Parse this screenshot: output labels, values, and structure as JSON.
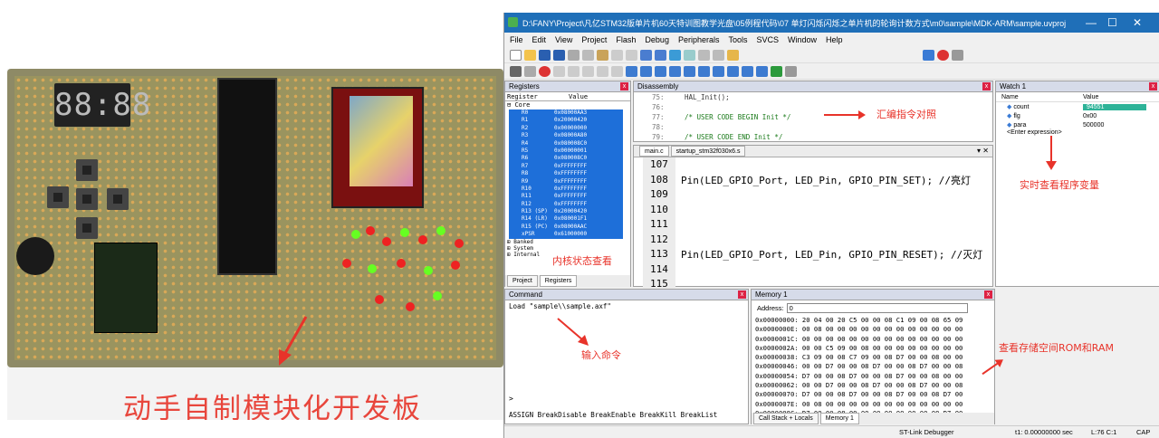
{
  "photo": {
    "caption": "动手自制模块化开发板",
    "display_digits": "88:88"
  },
  "ide": {
    "title": "D:\\FANY\\Project\\凡亿STM32版单片机60天特训图教学光盘\\05例程代码\\07 单灯闪烁闪烁之单片机的轮询计数方式\\m0\\sample\\MDK-ARM\\sample.uvprojx - µVision",
    "menu": [
      "File",
      "Edit",
      "View",
      "Project",
      "Flash",
      "Debug",
      "Peripherals",
      "Tools",
      "SVCS",
      "Window",
      "Help"
    ],
    "registers": {
      "title": "Registers",
      "col_register": "Register",
      "col_value": "Value",
      "group": "Core",
      "rows": [
        {
          "name": "R0",
          "value": "0x08000AA3"
        },
        {
          "name": "R1",
          "value": "0x20000420"
        },
        {
          "name": "R2",
          "value": "0x00000000"
        },
        {
          "name": "R3",
          "value": "0x08000A80"
        },
        {
          "name": "R4",
          "value": "0x080008C0"
        },
        {
          "name": "R5",
          "value": "0x00000001"
        },
        {
          "name": "R6",
          "value": "0x080008C0"
        },
        {
          "name": "R7",
          "value": "0xFFFFFFFF"
        },
        {
          "name": "R8",
          "value": "0xFFFFFFFF"
        },
        {
          "name": "R9",
          "value": "0xFFFFFFFF"
        },
        {
          "name": "R10",
          "value": "0xFFFFFFFF"
        },
        {
          "name": "R11",
          "value": "0xFFFFFFFF"
        },
        {
          "name": "R12",
          "value": "0xFFFFFFFF"
        },
        {
          "name": "R13 (SP)",
          "value": "0x20000420"
        },
        {
          "name": "R14 (LR)",
          "value": "0x080001F1"
        },
        {
          "name": "R15 (PC)",
          "value": "0x08000AAC"
        },
        {
          "name": "xPSR",
          "value": "0x61000000"
        }
      ],
      "other_groups": [
        "Banked",
        "System",
        "Internal"
      ],
      "tabs": [
        "Project",
        "Registers"
      ],
      "annotation": "内核状态查看"
    },
    "disassembly": {
      "title": "Disassembly",
      "lines": [
        {
          "ln": "75:",
          "code": "HAL_Init();"
        },
        {
          "ln": "76:",
          "code": ""
        },
        {
          "ln": "77:",
          "code": "/* USER CODE BEGIN Init */"
        },
        {
          "ln": "78:",
          "code": ""
        },
        {
          "ln": "79:",
          "code": "/* USER CODE END Init */"
        }
      ],
      "annotation": "汇编指令对照"
    },
    "editor": {
      "tabs": [
        "main.c",
        "startup_stm32f030x6.s"
      ],
      "lines": [
        {
          "ln": "107",
          "code": ""
        },
        {
          "ln": "108",
          "code": "Pin(LED_GPIO_Port, LED_Pin, GPIO_PIN_SET); //亮灯"
        },
        {
          "ln": "109",
          "code": ""
        },
        {
          "ln": "110",
          "code": ""
        },
        {
          "ln": "111",
          "code": ""
        },
        {
          "ln": "112",
          "code": ""
        },
        {
          "ln": "113",
          "code": "Pin(LED_GPIO_Port, LED_Pin, GPIO_PIN_RESET); //灭灯"
        },
        {
          "ln": "114",
          "code": ""
        },
        {
          "ln": "115",
          "code": ""
        }
      ]
    },
    "watch": {
      "title": "Watch 1",
      "col_name": "Name",
      "col_value": "Value",
      "rows": [
        {
          "name": "count",
          "value": "94551"
        },
        {
          "name": "flg",
          "value": "0x00"
        },
        {
          "name": "para",
          "value": "500000"
        }
      ],
      "enter_expr": "<Enter expression>",
      "annotation": "实时查看程序变量"
    },
    "command": {
      "title": "Command",
      "output": "Load \"sample\\\\sample.axf\"",
      "prompt": ">",
      "hint": "ASSIGN BreakDisable BreakEnable BreakKill BreakList",
      "annotation": "输入命令"
    },
    "memory": {
      "title": "Memory 1",
      "address_label": "Address:",
      "address_value": "0",
      "lines": [
        "0x00000000: 20 04 00 20 C5 00 00 08 C1 09 00 08 65 09",
        "0x0000000E: 00 08 00 00 00 00 00 00 00 00 00 00 00 00",
        "0x0000001C: 00 00 00 00 00 00 00 00 00 00 00 00 00 00",
        "0x0000002A: 00 00 C5 09 00 08 00 00 00 00 00 00 00 00",
        "0x00000038: C3 09 00 08 C7 09 00 08 D7 00 00 08 00 00",
        "0x00000046: 00 00 D7 00 00 08 D7 00 00 08 D7 00 00 08",
        "0x00000054: D7 00 00 08 D7 00 00 08 D7 00 00 08 00 00",
        "0x00000062: 00 00 D7 00 00 08 D7 00 00 08 D7 00 00 08",
        "0x00000070: D7 00 00 08 D7 00 00 08 D7 00 00 08 D7 00",
        "0x0000007E: 00 08 00 00 00 00 00 00 00 00 00 00 00 00",
        "0x0000008C: D7 00 00 08 00 00 00 00 00 00 00 08 D7 00"
      ],
      "tabs": [
        "Call Stack + Locals",
        "Memory 1"
      ],
      "annotation": "查看存储空间ROM和RAM"
    },
    "status": {
      "debugger": "ST-Link Debugger",
      "time": "t1: 0.00000000 sec",
      "position": "L:76 C:1",
      "caps": "CAP"
    }
  }
}
